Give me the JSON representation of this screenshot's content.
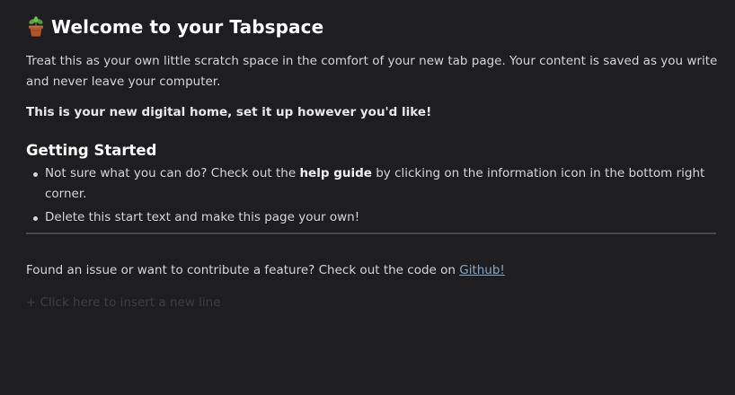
{
  "header": {
    "icon": "potted-plant-icon",
    "title": "Welcome to your Tabspace"
  },
  "intro": {
    "text": "Treat this as your own little scratch space in the comfort of your new tab page. Your content is saved as you write and never leave your computer."
  },
  "tagline": "This is your new digital home, set it up however you'd like!",
  "getting_started": {
    "heading": "Getting Started",
    "items": [
      {
        "before": "Not sure what you can do? Check out the ",
        "bold": "help guide",
        "after": " by clicking on the information icon in the bottom right corner."
      },
      {
        "text": "Delete this start text and make this page your own!"
      }
    ]
  },
  "footer": {
    "text": "Found an issue or want to contribute a feature? Check out the code on ",
    "link_label": "Github!"
  },
  "insert_line": {
    "label": "+ Click here to insert a new line"
  },
  "colors": {
    "background": "#1e1e20",
    "text": "#d6d6d6",
    "heading": "#ffffff",
    "link": "#8aa6c1",
    "divider": "#4a4a4c",
    "placeholder": "#3e3e41"
  }
}
